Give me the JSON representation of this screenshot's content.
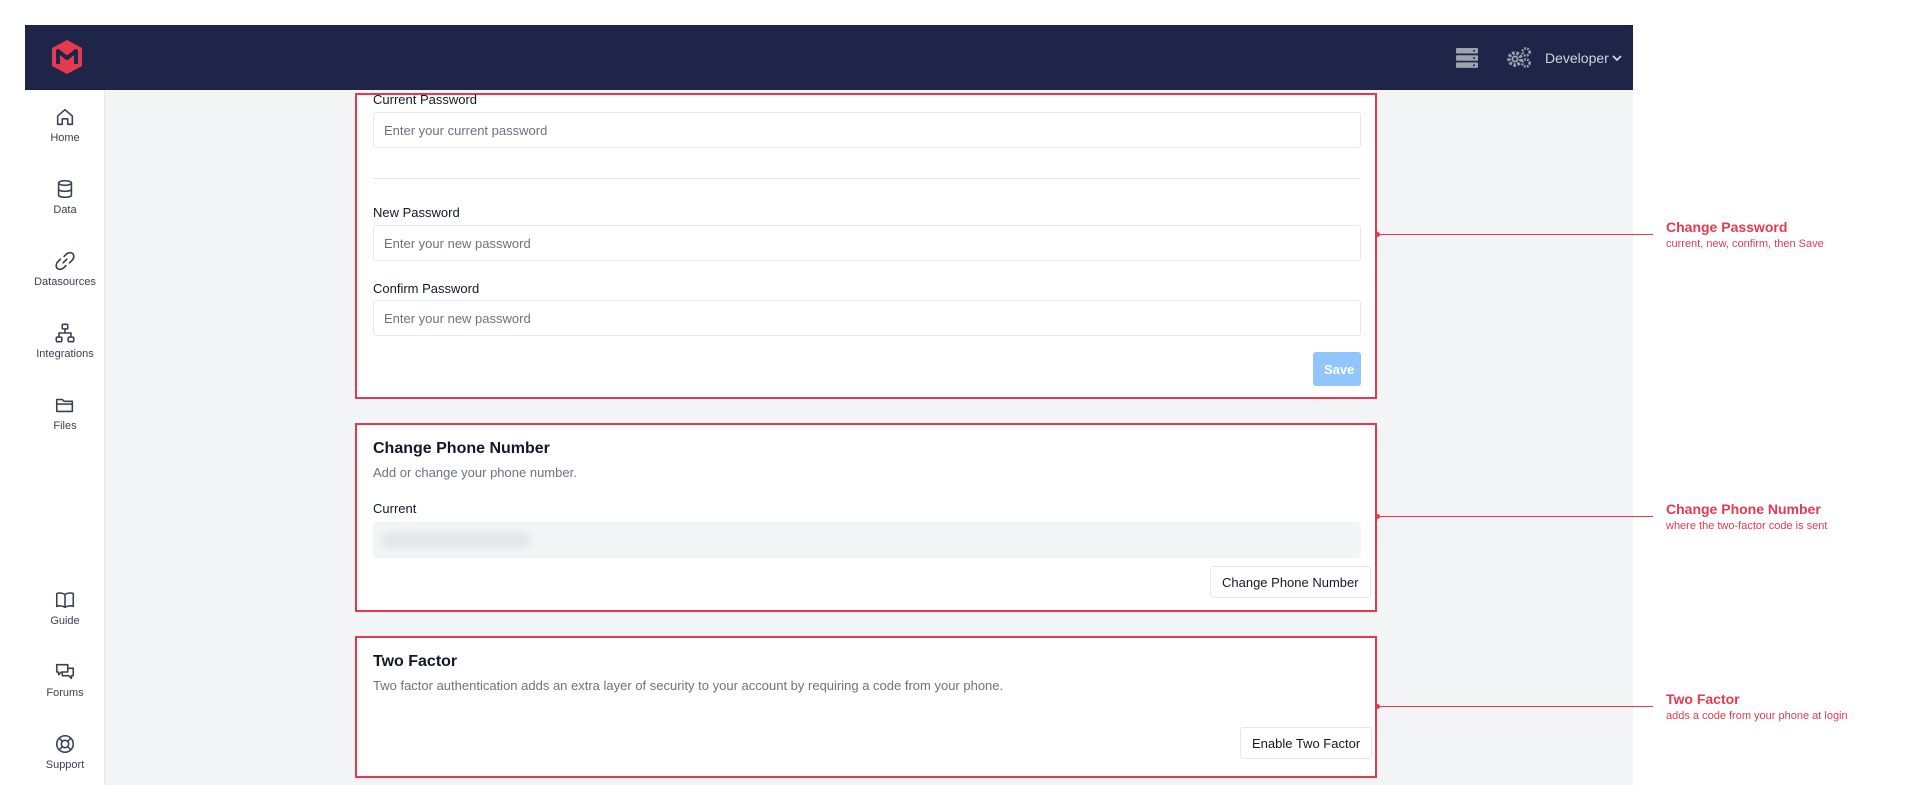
{
  "header": {
    "developer_label": "Developer",
    "icons": [
      "server-icon",
      "settings-cogs-icon",
      "chevron-down-icon"
    ],
    "background": "#1e2548"
  },
  "sidebar": {
    "top_items": [
      {
        "label": "Home",
        "icon": "home-icon"
      },
      {
        "label": "Data",
        "icon": "database-icon"
      },
      {
        "label": "Datasources",
        "icon": "link-icon"
      },
      {
        "label": "Integrations",
        "icon": "hierarchy-icon"
      },
      {
        "label": "Files",
        "icon": "folder-icon"
      }
    ],
    "bottom_items": [
      {
        "label": "Guide",
        "icon": "book-icon"
      },
      {
        "label": "Forums",
        "icon": "chat-icon"
      },
      {
        "label": "Support",
        "icon": "lifebuoy-icon"
      }
    ]
  },
  "password": {
    "current_label": "Current Password",
    "current_placeholder": "Enter your current password",
    "new_label": "New Password",
    "new_placeholder": "Enter your new password",
    "confirm_label": "Confirm Password",
    "confirm_placeholder": "Enter your new password",
    "save_label": "Save"
  },
  "phone": {
    "title": "Change Phone Number",
    "description": "Add or change your phone number.",
    "current_label": "Current",
    "button_label": "Change Phone Number"
  },
  "two_factor": {
    "title": "Two Factor",
    "description": "Two factor authentication adds an extra layer of security to your account by requiring a code from your phone.",
    "button_label": "Enable Two Factor"
  },
  "annotations": [
    {
      "title": "Change Password",
      "subtitle": "current, new, confirm, then Save"
    },
    {
      "title": "Change Phone Number",
      "subtitle": "where the two-factor code is sent"
    },
    {
      "title": "Two Factor",
      "subtitle": "adds a code from your phone at login"
    }
  ],
  "colors": {
    "annotation": "#e63950",
    "primary_disabled": "#93c5fd"
  }
}
